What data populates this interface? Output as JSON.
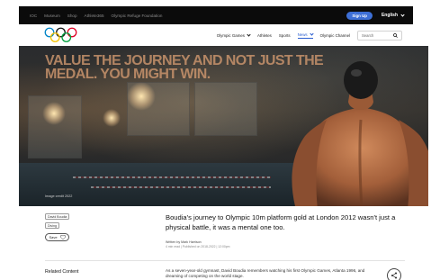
{
  "topbar": {
    "links": [
      "IOC",
      "Museum",
      "Shop",
      "Athlete365",
      "Olympic Refuge Foundation"
    ],
    "signup": "Sign Up",
    "language": "English"
  },
  "nav": {
    "items": [
      {
        "label": "Olympic Games",
        "dropdown": true,
        "active": false
      },
      {
        "label": "Athletes",
        "dropdown": false,
        "active": false
      },
      {
        "label": "Sports",
        "dropdown": false,
        "active": false
      },
      {
        "label": "News",
        "dropdown": true,
        "active": true
      },
      {
        "label": "Olympic Channel",
        "dropdown": false,
        "active": false
      }
    ],
    "search_placeholder": "Search"
  },
  "hero": {
    "title": "Value the journey and not just the medal. You might win.",
    "credit": "Image credit 2022"
  },
  "article": {
    "tags": [
      "David Boudia",
      "Diving"
    ],
    "save_label": "Save",
    "headline": "Boudia's journey to Olympic 10m platform gold at London 2012 wasn't just a physical battle, it was a mental one too.",
    "author": "Written by Mark Harrison",
    "meta": "4 min read | Published on 2018-2022 | 12:00pm",
    "related_title": "Related Content",
    "body": "As a seven-year-old gymnast, David Boudia remembers watching his first Olympic Games, Atlanta 1996, and dreaming of competing on the world stage."
  },
  "colors": {
    "accent": "#2c5fd0",
    "signup_bg": "#3d6fd6",
    "topbar_bg": "#0b0b0b",
    "hero_title": "#cd966e"
  },
  "icons": [
    "olympic-rings-logo",
    "chevron-down-icon",
    "search-icon",
    "heart-icon",
    "share-icon"
  ]
}
